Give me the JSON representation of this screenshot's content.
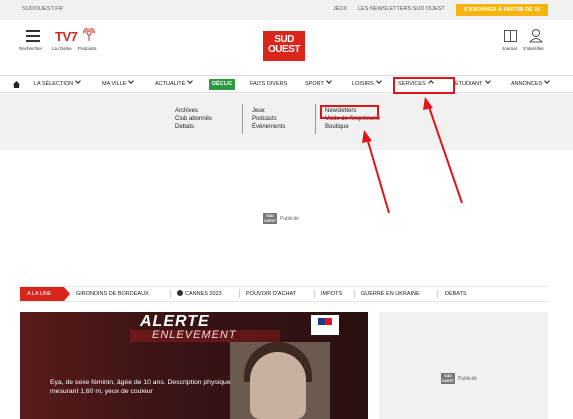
{
  "topbar": {
    "site": "SUDOUEST.FR",
    "jeux": "JEUX",
    "newsletters": "LES NEWSLETTERS SUD OUEST",
    "subscribe": "S'ABONNER À PARTIR DE 1€"
  },
  "header": {
    "search_label": "Rechercher",
    "tv7_logo": "TV7",
    "channel_label": "La chaîne",
    "podcasts_label": "Podcasts",
    "logo_line1": "SUD",
    "logo_line2": "OUEST",
    "journal_label": "Journal",
    "identify_label": "S'identifier"
  },
  "nav": {
    "items": [
      {
        "label": "LA SÉLECTION"
      },
      {
        "label": "MA VILLE"
      },
      {
        "label": "ACTUALITÉ"
      },
      {
        "label": "DÉCLIC"
      },
      {
        "label": "FAITS DIVERS"
      },
      {
        "label": "SPORT"
      },
      {
        "label": "LOISIRS"
      },
      {
        "label": "SERVICES"
      },
      {
        "label": "ÉTUDIANT"
      },
      {
        "label": "ANNONCES"
      }
    ],
    "declic_color": "#2e9a3e"
  },
  "dropdown": {
    "col1": [
      "Archives",
      "Club abonnés",
      "Debats"
    ],
    "col2": [
      "Jeux",
      "Podcasts",
      "Évènements"
    ],
    "col3": [
      "Newsletters",
      "Visite de l'imprimerie",
      "Boutique"
    ]
  },
  "ads": {
    "logo_line1": "SUD",
    "logo_line2": "OUEST",
    "label": "Publicité"
  },
  "topics": {
    "alaune": "A LA UNE",
    "items": [
      "GIRONDINS DE BORDEAUX",
      "CANNES 2023",
      "POUVOIR D'ACHAT",
      "IMPOTS",
      "GUERRE EN UKRAINE",
      "DÉBATS"
    ]
  },
  "article": {
    "alerte": "ALERTE",
    "enlevement": "ENLEVEMENT",
    "description": "Eya, de sexe féminin, âgée de 10 ans. Description physique mesurant 1,60 m, yeux de couleur"
  },
  "colors": {
    "brand_red": "#d9251c",
    "subscribe_yellow": "#f5b50f",
    "annotation_red": "#e0141b"
  }
}
